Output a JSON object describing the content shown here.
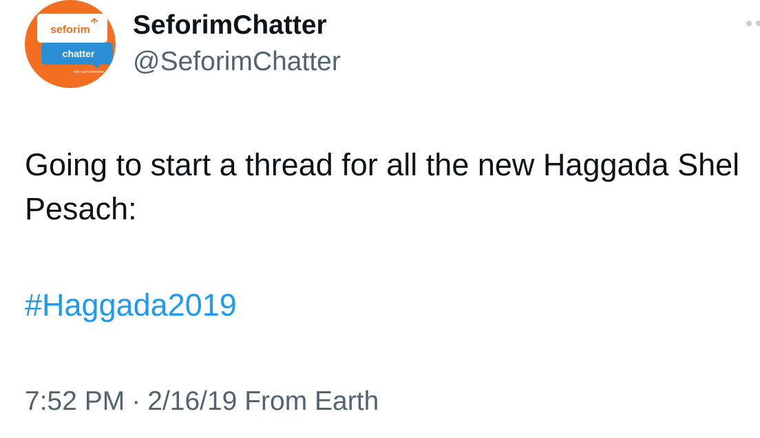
{
  "account": {
    "display_name": "SeforimChatter",
    "handle": "@SeforimChatter",
    "avatar": {
      "logo_top_text": "seforim",
      "logo_bottom_text": "chatter",
      "logo_caption": "with nachi weinstein",
      "background_color": "#f26f21",
      "accent_color": "#2b8fd6"
    }
  },
  "tweet": {
    "text": "Going to start a thread for all the new Haggada Shel Pesach:",
    "hashtag": "#Haggada2019",
    "time": "7:52 PM",
    "separator": "·",
    "date": "2/16/19",
    "source": "From Earth"
  },
  "colors": {
    "text_primary": "#0f1419",
    "text_secondary": "#536471",
    "link": "#1d9bf0"
  },
  "icons": {
    "more": "more-dots-icon"
  }
}
